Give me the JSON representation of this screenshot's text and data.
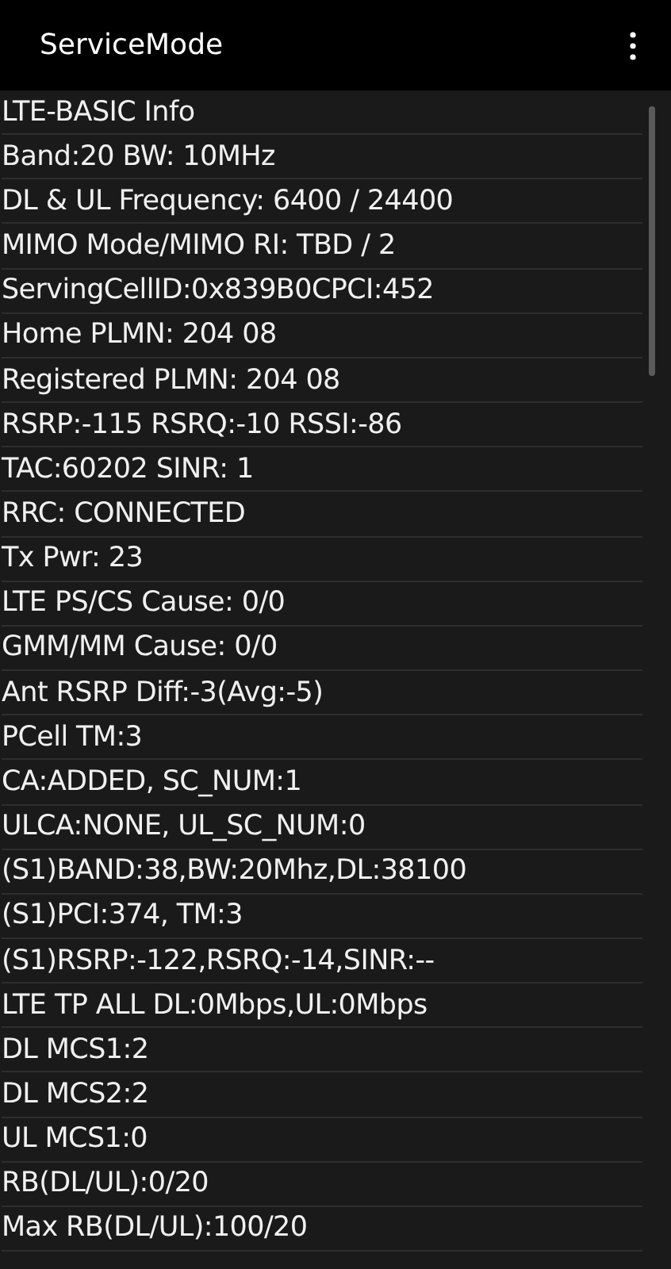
{
  "app_bar": {
    "title": "ServiceMode"
  },
  "lines": [
    "LTE-BASIC Info",
    "Band:20 BW: 10MHz",
    "DL & UL Frequency: 6400 / 24400",
    "MIMO Mode/MIMO RI: TBD / 2",
    "ServingCellID:0x839B0CPCI:452",
    "Home PLMN: 204 08",
    "Registered PLMN: 204 08",
    "RSRP:-115 RSRQ:-10 RSSI:-86",
    "TAC:60202 SINR: 1",
    "RRC: CONNECTED",
    "Tx Pwr: 23",
    "LTE PS/CS Cause: 0/0",
    "GMM/MM Cause: 0/0",
    "Ant RSRP Diff:-3(Avg:-5)",
    "PCell TM:3",
    "CA:ADDED, SC_NUM:1",
    "ULCA:NONE, UL_SC_NUM:0",
    "(S1)BAND:38,BW:20Mhz,DL:38100",
    "(S1)PCI:374, TM:3",
    "(S1)RSRP:-122,RSRQ:-14,SINR:--",
    "LTE TP ALL DL:0Mbps,UL:0Mbps",
    "DL MCS1:2",
    "DL MCS2:2",
    "UL MCS1:0",
    "RB(DL/UL):0/20",
    "Max RB(DL/UL):100/20"
  ]
}
